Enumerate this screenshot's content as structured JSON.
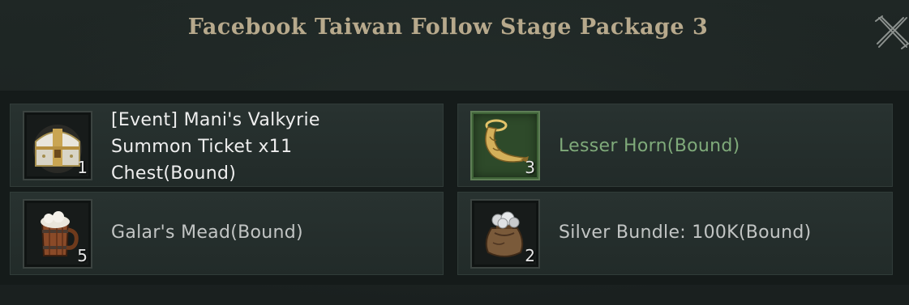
{
  "dialog": {
    "title": "Facebook Taiwan Follow Stage Package 3",
    "close_icon": "close-x-icon"
  },
  "items": [
    {
      "name": "[Event] Mani's Valkyrie Summon Ticket x11 Chest(Bound)",
      "name_lines": [
        "[Event] Mani's Valkyrie",
        "Summon Ticket x11",
        "Chest(Bound)"
      ],
      "quantity": "1",
      "icon": "treasure-chest-icon",
      "name_color": "#eeeeee"
    },
    {
      "name": "Lesser Horn(Bound)",
      "quantity": "3",
      "icon": "golden-horn-icon",
      "name_color": "#7faa7a"
    },
    {
      "name": "Galar's Mead(Bound)",
      "quantity": "5",
      "icon": "mead-mug-icon",
      "name_color": "#c2c5c4"
    },
    {
      "name": "Silver Bundle: 100K(Bound)",
      "quantity": "2",
      "icon": "silver-sack-icon",
      "name_color": "#c2c5c4"
    }
  ]
}
